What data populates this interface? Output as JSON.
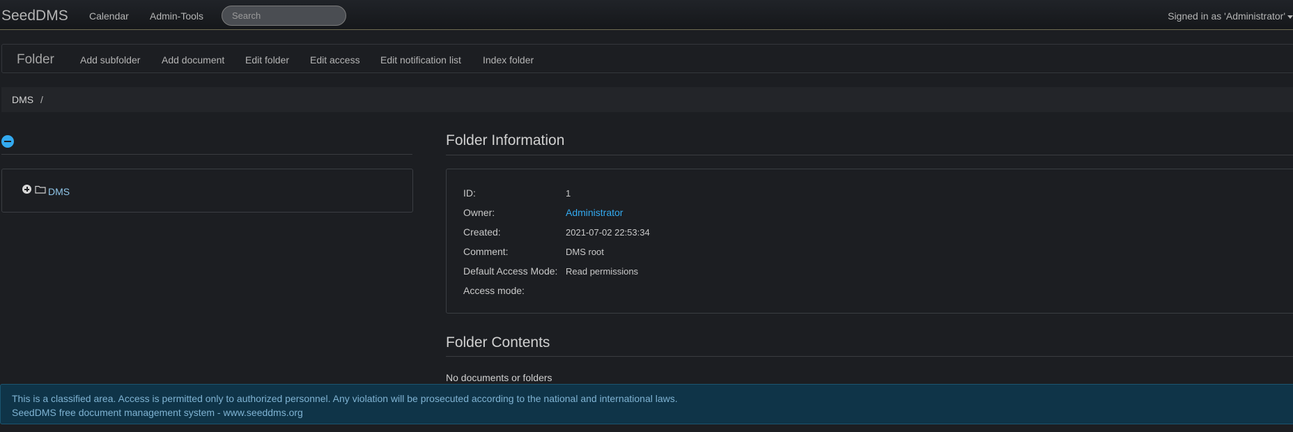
{
  "navbar": {
    "brand": "SeedDMS",
    "links": [
      "Calendar",
      "Admin-Tools"
    ],
    "search_placeholder": "Search",
    "user_menu": "Signed in as 'Administrator'"
  },
  "subnav": {
    "title": "Folder",
    "actions": [
      "Add subfolder",
      "Add document",
      "Edit folder",
      "Edit access",
      "Edit notification list",
      "Index folder"
    ]
  },
  "breadcrumb": {
    "items": [
      "DMS"
    ],
    "separator": "/"
  },
  "tree": {
    "root_label": "DMS"
  },
  "folder_info": {
    "title": "Folder Information",
    "rows": [
      {
        "label": "ID:",
        "value": "1"
      },
      {
        "label": "Owner:",
        "value": "Administrator"
      },
      {
        "label": "Created:",
        "value": "2021-07-02 22:53:34"
      },
      {
        "label": "Comment:",
        "value": "DMS root"
      },
      {
        "label": "Default Access Mode:",
        "value": "Read permissions"
      },
      {
        "label": "Access mode:",
        "value": ""
      }
    ]
  },
  "folder_contents": {
    "title": "Folder Contents",
    "empty_text": "No documents or folders"
  },
  "footer": {
    "notice": "This is a classified area. Access is permitted only to authorized personnel. Any violation will be prosecuted according to the national and international laws.",
    "credit": "SeedDMS free document management system - www.seeddms.org"
  },
  "colors": {
    "accent": "#33aaf0",
    "background": "#1c1e22",
    "footer_bg": "#0f3448"
  }
}
